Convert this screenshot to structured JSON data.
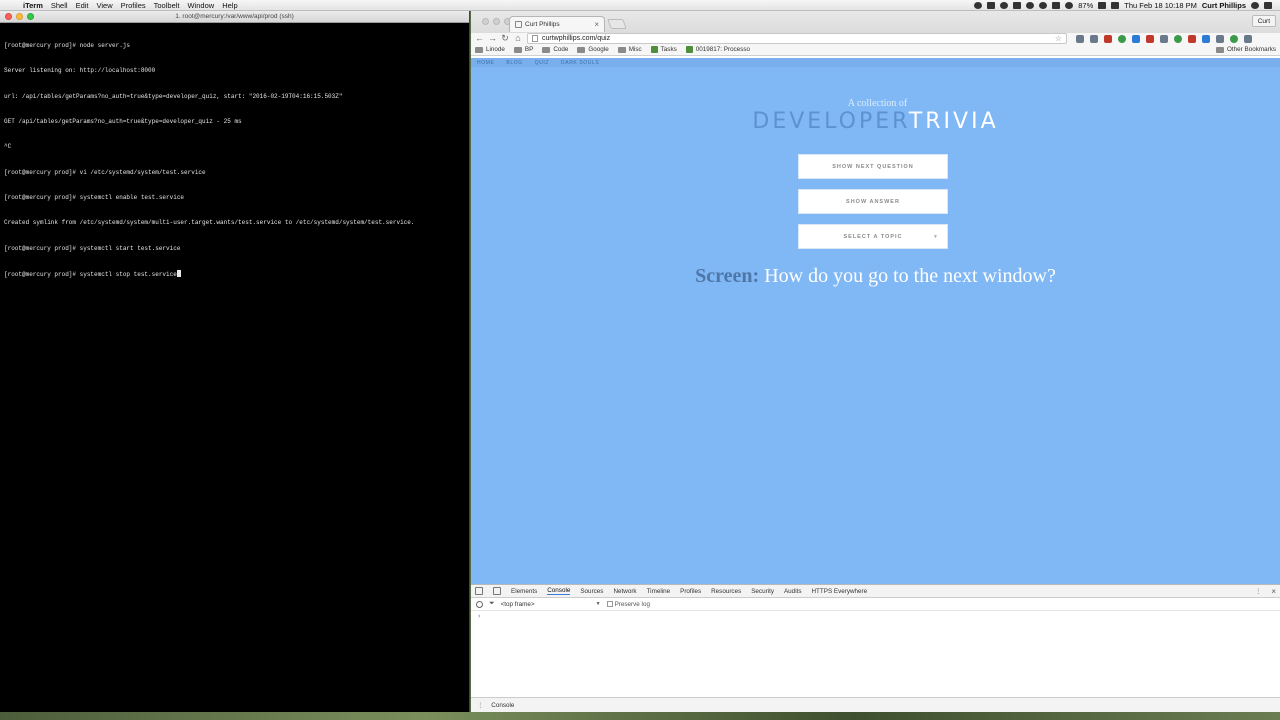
{
  "menubar": {
    "items": [
      "iTerm",
      "Shell",
      "Edit",
      "View",
      "Profiles",
      "Toolbelt",
      "Window",
      "Help"
    ],
    "battery": "87%",
    "clock": "Thu Feb 18  10:18 PM",
    "user": "Curt Phillips"
  },
  "iterm": {
    "title": "1. root@mercury:/var/www/api/prod (ssh)",
    "lines": [
      "[root@mercury prod]# node server.js",
      "Server listening on: http://localhost:8000",
      "url: /api/tables/getParams?no_auth=true&type=developer_quiz, start: \"2016-02-19T04:16:15.503Z\"",
      "GET /api/tables/getParams?no_auth=true&type=developer_quiz - 25 ms",
      "^C",
      "[root@mercury prod]# vi /etc/systemd/system/test.service",
      "[root@mercury prod]# systemctl enable test.service",
      "Created symlink from /etc/systemd/system/multi-user.target.wants/test.service to /etc/systemd/system/test.service.",
      "[root@mercury prod]# systemctl start test.service",
      "[root@mercury prod]# systemctl stop test.service"
    ]
  },
  "chrome": {
    "tab_title": "Curt Phillips",
    "profile": "Curt",
    "url": "curtwphillips.com/quiz",
    "bookmarks": [
      "Linode",
      "BP",
      "Code",
      "Google",
      "Misc",
      "Tasks",
      "0019817: Processo"
    ],
    "other_bookmarks": "Other Bookmarks"
  },
  "site": {
    "nav": [
      "HOME",
      "BLOG",
      "QUIZ",
      "DARK SOULS"
    ],
    "subtitle": "A collection of",
    "brand_part1": "DEVELOPER",
    "brand_part2": "TRIVIA",
    "btn_next": "SHOW NEXT QUESTION",
    "btn_answer": "SHOW ANSWER",
    "btn_topic": "SELECT A TOPIC",
    "question_category": "Screen:",
    "question_text": "How do you go to the next window?",
    "colors": {
      "page_bg": "#80b7f5",
      "brand_dim": "#5d92d0"
    }
  },
  "devtools": {
    "tabs": [
      "Elements",
      "Console",
      "Sources",
      "Network",
      "Timeline",
      "Profiles",
      "Resources",
      "Security",
      "Audits",
      "HTTPS Everywhere"
    ],
    "active_tab": "Console",
    "frame": "<top frame>",
    "preserve_log": "Preserve log",
    "prompt": "›",
    "drawer_tab": "Console"
  }
}
